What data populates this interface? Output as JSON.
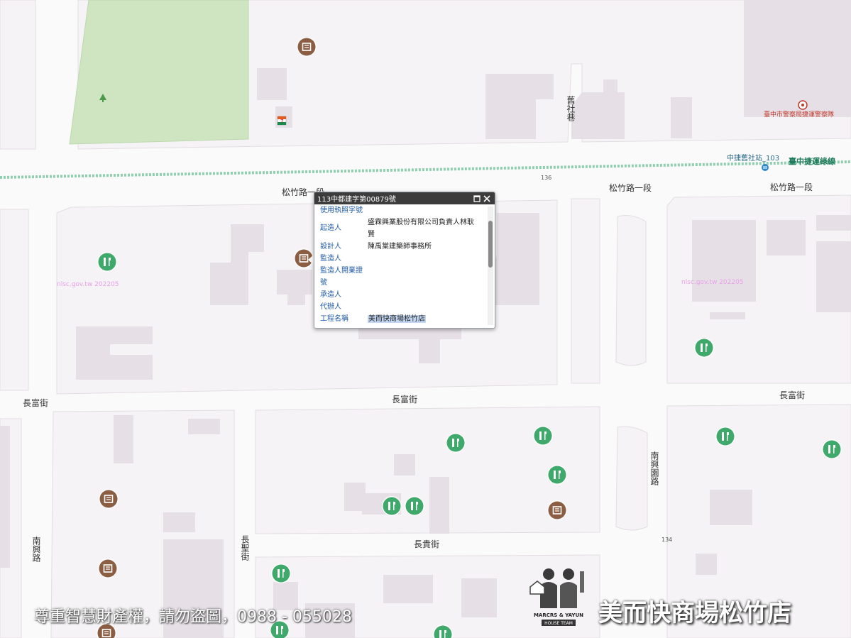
{
  "roads": {
    "songzhu_1": "松竹路一段",
    "songzhu_2": "松竹路一段",
    "songzhu_3": "松竹路一段",
    "changfu_left": "長富街",
    "changfu_mid": "長富街",
    "changfu_right": "長富街",
    "changgui": "長貴街",
    "nanxing_rd": "南興路",
    "changsheng": "長聖街",
    "nanxing_yuan": "南興園路",
    "jiushe_alley": "舊社巷"
  },
  "labels": {
    "police": "臺中市警察局捷運警察隊",
    "mrt_station": "中捷舊社站_103",
    "mrt_line": "臺中捷運綠線",
    "mark_136": "136",
    "mark_134": "134",
    "nlsc_left": "nlsc.gov.tw 202205",
    "nlsc_right": "nlsc.gov.tw 202205"
  },
  "popup": {
    "title": "113中都建字第00879號",
    "rows": [
      {
        "key": "使用執照字號",
        "value": ""
      },
      {
        "key": "起造人",
        "value": "盛霖興業股份有限公司負責人林耿賢"
      },
      {
        "key": "設計人",
        "value": "陳禹棠建築師事務所"
      },
      {
        "key": "監造人",
        "value": ""
      },
      {
        "key": "監造人開業證號",
        "value": ""
      },
      {
        "key": "承造人",
        "value": ""
      },
      {
        "key": "代辦人",
        "value": ""
      },
      {
        "key": "工程名稱",
        "value": "美而快商場松竹店"
      }
    ]
  },
  "watermark": {
    "copyright": "尊重智慧財產權，請勿盜圖，0988 - 055028",
    "store_name": "美而快商場松竹店",
    "logo_line1": "MARCRS & YAYUN",
    "logo_line2": "HOUSE TEAM"
  },
  "colors": {
    "park": "#cfe5c2",
    "block": "#f7f6f7",
    "building": "#e5dfe5",
    "road": "#ffffff",
    "mrt_line": "#8fd0b4",
    "green_marker": "#3fa86b",
    "brown_marker": "#8b5e44"
  },
  "icons": {
    "green_marker": "construction-tools-icon",
    "brown_marker": "building-permit-icon",
    "tree": "tree-icon",
    "seven_eleven": "convenience-store-icon",
    "police": "police-icon",
    "mrt": "mrt-station-icon"
  }
}
